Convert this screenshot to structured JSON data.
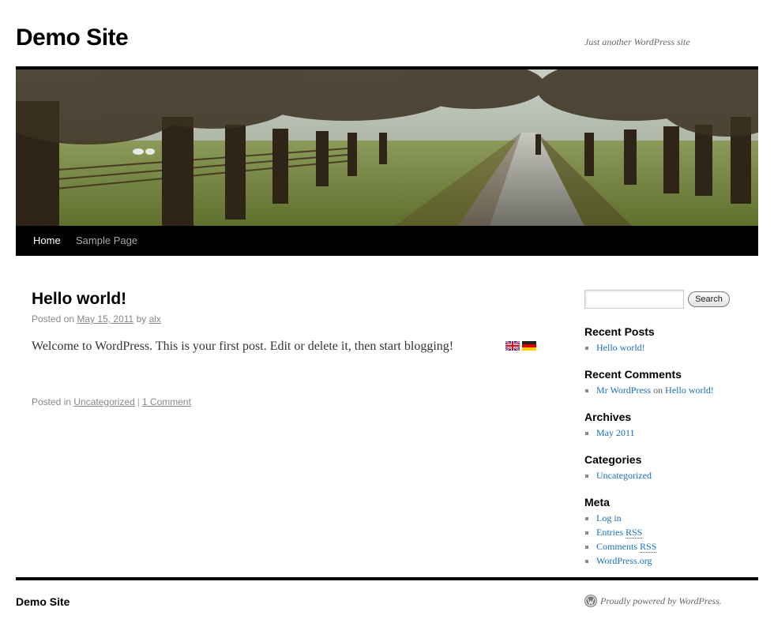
{
  "header": {
    "site_title": "Demo Site",
    "site_description": "Just another WordPress site"
  },
  "nav": {
    "items": [
      {
        "label": "Home",
        "active": true
      },
      {
        "label": "Sample Page",
        "active": false
      }
    ]
  },
  "post": {
    "title": "Hello world!",
    "meta": {
      "posted_on_prefix": "Posted on",
      "date": "May 15, 2011",
      "by": "by",
      "author": "alx"
    },
    "content": "Welcome to WordPress. This is your first post. Edit or delete it, then start blogging!",
    "footer": {
      "posted_in_prefix": "Posted in",
      "category": "Uncategorized",
      "separator": "|",
      "comments": "1 Comment"
    },
    "language_flags": [
      "uk-flag-icon",
      "germany-flag-icon"
    ]
  },
  "sidebar": {
    "search": {
      "placeholder": "",
      "value": "",
      "button_label": "Search"
    },
    "recent_posts": {
      "title": "Recent Posts",
      "items": [
        "Hello world!"
      ]
    },
    "recent_comments": {
      "title": "Recent Comments",
      "items": [
        {
          "author": "Mr WordPress",
          "on": "on",
          "post": "Hello world!"
        }
      ]
    },
    "archives": {
      "title": "Archives",
      "items": [
        "May 2011"
      ]
    },
    "categories": {
      "title": "Categories",
      "items": [
        "Uncategorized"
      ]
    },
    "meta": {
      "title": "Meta",
      "log_in": "Log in",
      "entries_prefix": "Entries",
      "comments_prefix": "Comments",
      "rss": "RSS",
      "wordpress_org": "WordPress.org"
    }
  },
  "footer": {
    "site_title": "Demo Site",
    "powered_by": "Proudly powered by WordPress."
  },
  "colors": {
    "link": "#1b6fb8",
    "nav_bg": "#000000",
    "meta_text": "#888888"
  }
}
